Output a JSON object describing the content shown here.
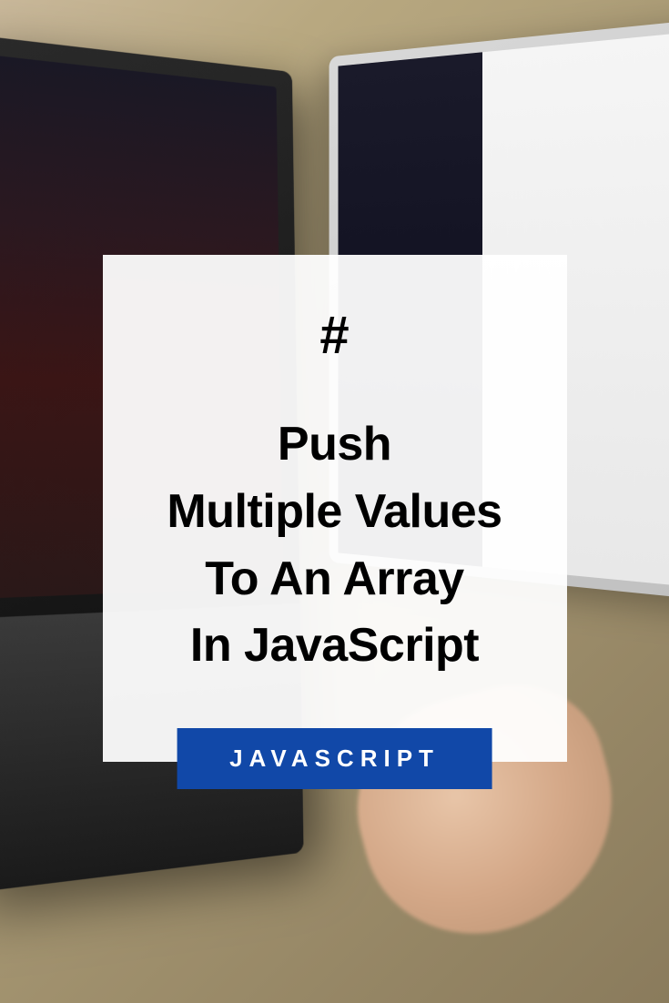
{
  "card": {
    "hash_symbol": "#",
    "title_line1": "Push",
    "title_line2": "Multiple Values",
    "title_line3": "To An Array",
    "title_line4": "In JavaScript"
  },
  "badge": {
    "label": "JAVASCRIPT"
  }
}
